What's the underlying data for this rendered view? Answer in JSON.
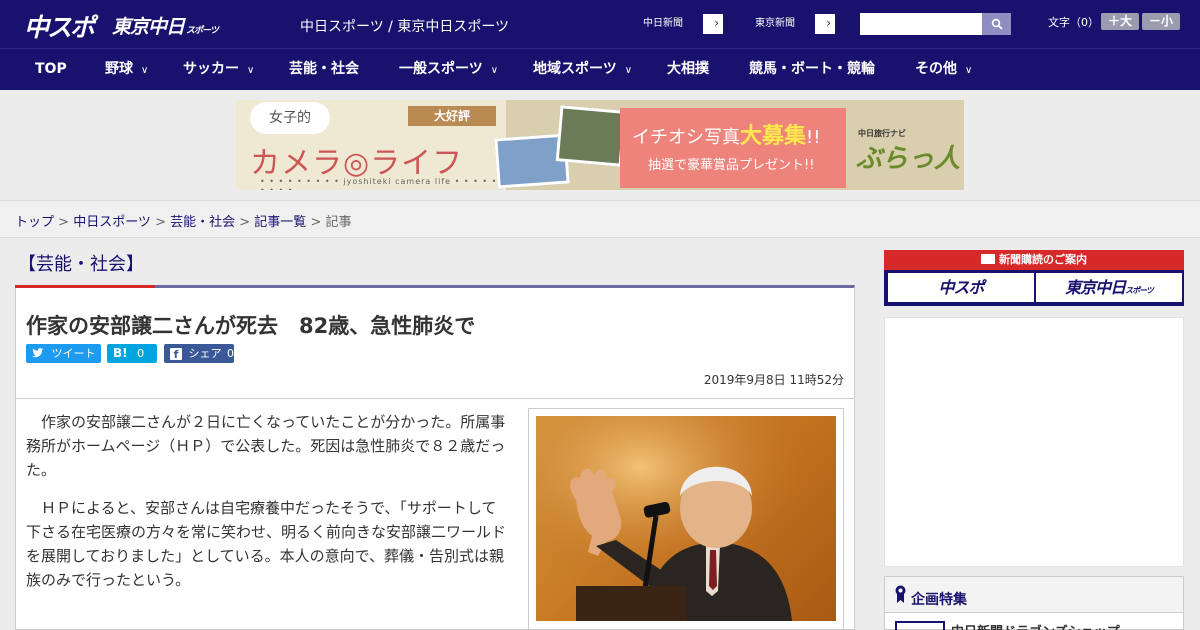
{
  "header": {
    "logo_main": "中スポ",
    "logo_sub": "東京中日",
    "logo_sub_small": "スポーツ",
    "site_title": "中日スポーツ / 東京中日スポーツ",
    "links": [
      "中日新聞",
      "東京新聞"
    ],
    "font_size_label": "文字（0）",
    "font_larger": "＋大",
    "font_smaller": "－小"
  },
  "nav": {
    "items": [
      {
        "label": "TOP",
        "has_menu": false
      },
      {
        "label": "野球",
        "has_menu": true
      },
      {
        "label": "サッカー",
        "has_menu": true
      },
      {
        "label": "芸能・社会",
        "has_menu": false
      },
      {
        "label": "一般スポーツ",
        "has_menu": true
      },
      {
        "label": "地域スポーツ",
        "has_menu": true
      },
      {
        "label": "大相撲",
        "has_menu": false
      },
      {
        "label": "競馬・ボート・競輪",
        "has_menu": false
      },
      {
        "label": "その他",
        "has_menu": true
      }
    ]
  },
  "banner": {
    "bubble": "女子的",
    "title": "カメラ◎ライフ",
    "romaji": "• • • • • • • • • jyoshiteki camera life • • • • • • • • •",
    "ribbon": "大好評",
    "headline_pre": "イチオシ写真",
    "headline_em": "大募集",
    "headline_post": "!!",
    "sub": "抽選で豪華賞品プレゼント!!",
    "navi": "中日旅行ナビ",
    "brand": "ぶらっ人"
  },
  "breadcrumb": {
    "items": [
      "トップ",
      "中日スポーツ",
      "芸能・社会",
      "記事一覧"
    ],
    "current": "記事"
  },
  "article": {
    "category": "【芸能・社会】",
    "headline": "作家の安部譲二さんが死去　82歳、急性肺炎で",
    "share": {
      "tweet": "ツイート",
      "hatena_count": "0",
      "share_label": "シェア",
      "share_count": "0"
    },
    "date": "2019年9月8日 11時52分",
    "paragraphs": [
      "作家の安部譲二さんが２日に亡くなっていたことが分かった。所属事務所がホームページ（ＨＰ）で公表した。死因は急性肺炎で８２歳だった。",
      "ＨＰによると、安部さんは自宅療養中だったそうで、「サポートして下さる在宅医療の方々を常に笑わせ、明るく前向きな安部譲二ワールドを展開しておりました」としている。本人の意向で、葬儀・告別式は親族のみで行ったという。"
    ]
  },
  "sidebar": {
    "subscribe_head": "新聞購読のご案内",
    "subscribe_buttons": [
      "中スポ",
      "東京中日"
    ],
    "subscribe_small": "スポーツ",
    "feature_title": "企画特集",
    "feature_item": "中日新聞ドラゴンズショップ"
  },
  "colors": {
    "brand_navy": "#18126e",
    "accent_red": "#d7282a",
    "twitter_blue": "#1d9bf0",
    "hatena_blue": "#00a4de",
    "facebook_blue": "#3b5998"
  }
}
